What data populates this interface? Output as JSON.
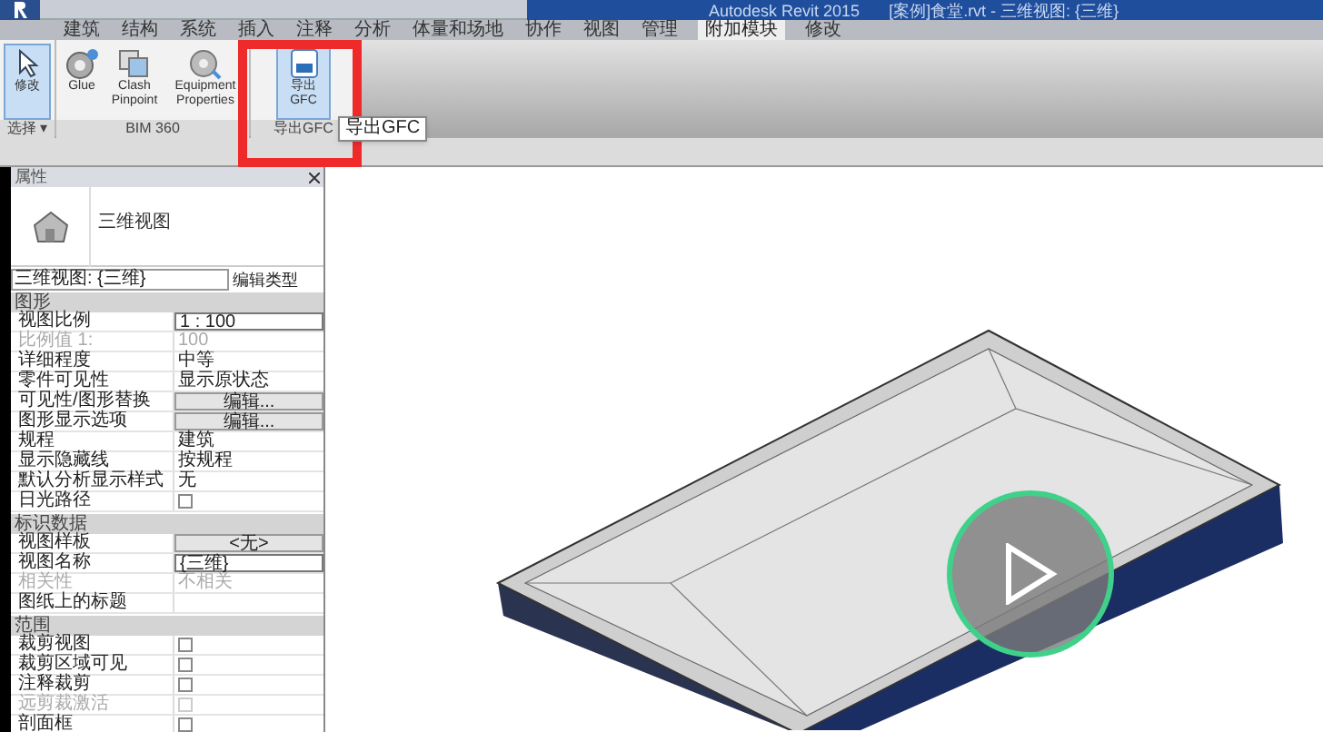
{
  "window": {
    "title": "Autodesk Revit 2015",
    "document": "[案例]食堂.rvt - 三维视图: {三维}"
  },
  "tabs": [
    {
      "label": "建筑",
      "selected": false
    },
    {
      "label": "结构",
      "selected": false
    },
    {
      "label": "系统",
      "selected": false
    },
    {
      "label": "插入",
      "selected": false
    },
    {
      "label": "注释",
      "selected": false
    },
    {
      "label": "分析",
      "selected": false
    },
    {
      "label": "体量和场地",
      "selected": false
    },
    {
      "label": "协作",
      "selected": false
    },
    {
      "label": "视图",
      "selected": false
    },
    {
      "label": "管理",
      "selected": false
    },
    {
      "label": "附加模块",
      "selected": true
    },
    {
      "label": "修改",
      "selected": false
    }
  ],
  "ribbon": {
    "panels": [
      {
        "label": "选择 ▾",
        "tools": [
          {
            "label": "修改",
            "kind": "pointer",
            "selected": true
          }
        ]
      },
      {
        "label": "BIM 360",
        "tools": [
          {
            "label": "Glue",
            "kind": "glue",
            "selected": false
          },
          {
            "label": "Clash Pinpoint",
            "kind": "clash",
            "selected": false
          },
          {
            "label": "Equipment Properties",
            "kind": "equipment",
            "selected": false
          }
        ]
      },
      {
        "label": "导出GFC",
        "tools": [
          {
            "label": "导出GFC",
            "kind": "gfc",
            "selected": true
          }
        ]
      }
    ],
    "tooltip": "导出GFC"
  },
  "properties": {
    "title": "属性",
    "type_name": "三维视图",
    "type_selector": "三维视图: {三维}",
    "edit_type": "编辑类型",
    "groups": [
      {
        "name": "图形",
        "rows": [
          {
            "label": "视图比例",
            "value": "1 : 100",
            "kind": "input",
            "disabled": false
          },
          {
            "label": "比例值 1:",
            "value": "100",
            "kind": "text",
            "disabled": true
          },
          {
            "label": "详细程度",
            "value": "中等",
            "kind": "text",
            "disabled": false
          },
          {
            "label": "零件可见性",
            "value": "显示原状态",
            "kind": "text",
            "disabled": false
          },
          {
            "label": "可见性/图形替换",
            "value": "编辑...",
            "kind": "button",
            "disabled": false
          },
          {
            "label": "图形显示选项",
            "value": "编辑...",
            "kind": "button",
            "disabled": false
          },
          {
            "label": "规程",
            "value": "建筑",
            "kind": "text",
            "disabled": false
          },
          {
            "label": "显示隐藏线",
            "value": "按规程",
            "kind": "text",
            "disabled": false
          },
          {
            "label": "默认分析显示样式",
            "value": "无",
            "kind": "text",
            "disabled": false
          },
          {
            "label": "日光路径",
            "kind": "checkbox",
            "checked": false,
            "disabled": false
          }
        ]
      },
      {
        "name": "标识数据",
        "rows": [
          {
            "label": "视图样板",
            "value": "<无>",
            "kind": "button",
            "disabled": false
          },
          {
            "label": "视图名称",
            "value": "{三维}",
            "kind": "input",
            "disabled": false
          },
          {
            "label": "相关性",
            "value": "不相关",
            "kind": "text",
            "disabled": true
          },
          {
            "label": "图纸上的标题",
            "kind": "text",
            "disabled": false
          }
        ]
      },
      {
        "name": "范围",
        "rows": [
          {
            "label": "裁剪视图",
            "kind": "checkbox",
            "checked": false,
            "disabled": false
          },
          {
            "label": "裁剪区域可见",
            "kind": "checkbox",
            "checked": false,
            "disabled": false
          },
          {
            "label": "注释裁剪",
            "kind": "checkbox",
            "checked": false,
            "disabled": false
          },
          {
            "label": "远剪裁激活",
            "kind": "checkbox",
            "checked": false,
            "disabled": true
          },
          {
            "label": "剖面框",
            "kind": "checkbox",
            "checked": false,
            "disabled": false
          }
        ]
      }
    ]
  }
}
